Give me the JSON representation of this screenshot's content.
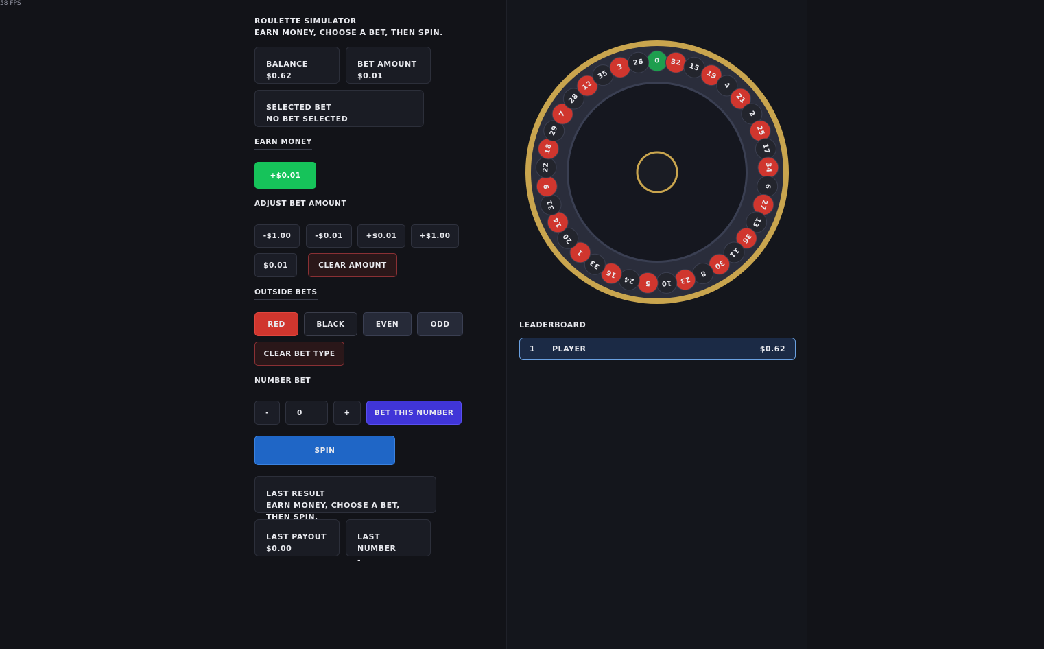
{
  "fps": "58 FPS",
  "header": {
    "title": "ROULETTE SIMULATOR",
    "subtitle": "EARN MONEY, CHOOSE A BET, THEN SPIN."
  },
  "balance": {
    "label": "BALANCE",
    "value": "$0.62"
  },
  "bet_amount": {
    "label": "BET AMOUNT",
    "value": "$0.01"
  },
  "selected_bet": {
    "label": "SELECTED BET",
    "value": "NO BET SELECTED"
  },
  "earn": {
    "label": "EARN MONEY",
    "button": "+$0.01"
  },
  "adjust": {
    "label": "ADJUST BET AMOUNT",
    "minus_dollar": "-$1.00",
    "minus_cent": "-$0.01",
    "plus_cent": "+$0.01",
    "plus_dollar": "+$1.00",
    "current": "$0.01",
    "clear": "CLEAR AMOUNT"
  },
  "outside": {
    "label": "OUTSIDE BETS",
    "red": "RED",
    "black": "BLACK",
    "even": "EVEN",
    "odd": "ODD",
    "clear": "CLEAR BET TYPE"
  },
  "number_bet": {
    "label": "NUMBER BET",
    "minus": "-",
    "value": "0",
    "plus": "+",
    "bet": "BET THIS NUMBER"
  },
  "spin": "SPIN",
  "last_result": {
    "label": "LAST RESULT",
    "value": "EARN MONEY, CHOOSE A BET, THEN SPIN."
  },
  "last_payout": {
    "label": "LAST PAYOUT",
    "value": "$0.00"
  },
  "last_number": {
    "label": "LAST NUMBER",
    "value": "-"
  },
  "leaderboard": {
    "label": "LEADERBOARD",
    "rows": [
      {
        "rank": "1",
        "name": "PLAYER",
        "amount": "$0.62"
      }
    ]
  },
  "wheel": {
    "numbers": [
      "0",
      "32",
      "15",
      "19",
      "4",
      "21",
      "2",
      "25",
      "17",
      "34",
      "6",
      "27",
      "13",
      "36",
      "11",
      "30",
      "8",
      "23",
      "10",
      "5",
      "24",
      "16",
      "33",
      "1",
      "20",
      "14",
      "31",
      "9",
      "22",
      "18",
      "29",
      "7",
      "28",
      "12",
      "35",
      "3",
      "26"
    ],
    "red_numbers": [
      "1",
      "3",
      "5",
      "7",
      "9",
      "12",
      "14",
      "16",
      "18",
      "19",
      "21",
      "23",
      "25",
      "27",
      "30",
      "32",
      "34",
      "36"
    ],
    "colors": {
      "red": "#d0362e",
      "black": "#23252d",
      "green": "#1e9e4e",
      "rim": "#c9a54e",
      "track": "#2a2d3b"
    }
  }
}
